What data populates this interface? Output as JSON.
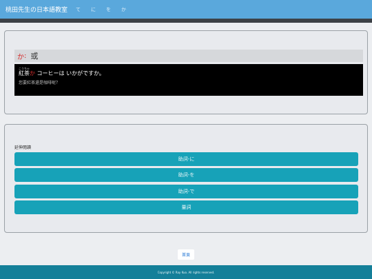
{
  "header": {
    "brand": "桃田先生の日本語教室",
    "nav": [
      "て",
      "に",
      "を",
      "か"
    ]
  },
  "question": {
    "kana": "か",
    "separator": ":",
    "kanji": "或",
    "furigana": "こうちゃ",
    "sentence_word": "紅茶",
    "sentence_particle": "か",
    "sentence_rest": " コーヒーは いかがですか。",
    "translation": "您要紅茶還是咖啡呢？"
  },
  "options": {
    "label": "延伸閱讀",
    "buttons": [
      "助詞-に",
      "助詞-を",
      "助詞-で",
      "量詞"
    ]
  },
  "home_label": "首頁",
  "footer_text": "Copyright © Ray Kuo. All rights reserved."
}
